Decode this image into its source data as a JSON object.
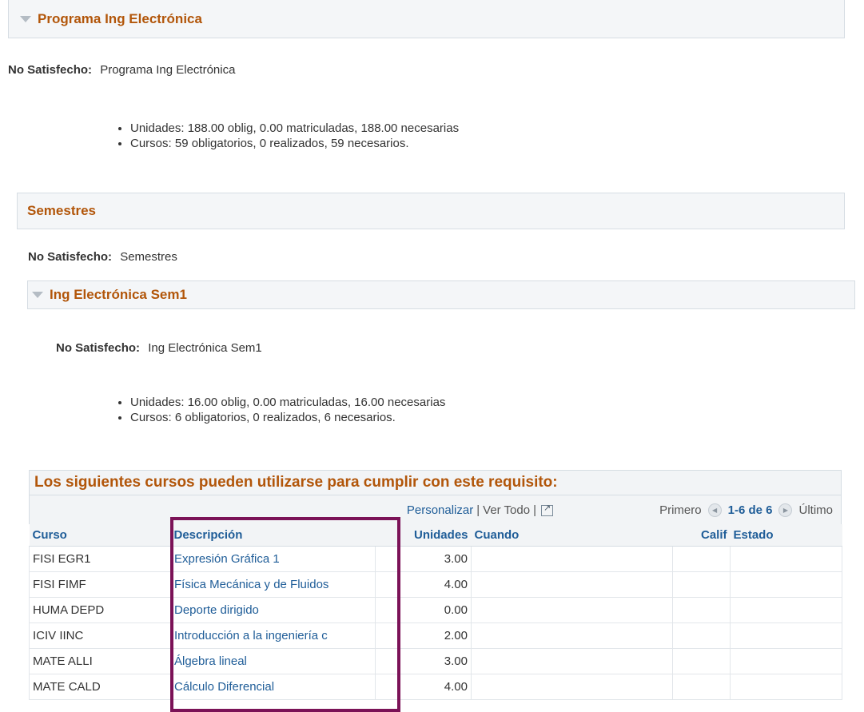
{
  "program": {
    "title": "Programa Ing Electrónica",
    "status_label": "No Satisfecho:",
    "status_value": "Programa Ing Electrónica",
    "facts": [
      "Unidades: 188.00 oblig, 0.00 matriculadas, 188.00 necesarias",
      "Cursos: 59 obligatorios, 0 realizados, 59 necesarios."
    ]
  },
  "semestres": {
    "title": "Semestres",
    "status_label": "No Satisfecho:",
    "status_value": "Semestres"
  },
  "sem1": {
    "title": "Ing Electrónica Sem1",
    "status_label": "No Satisfecho:",
    "status_value": "Ing Electrónica Sem1",
    "facts": [
      "Unidades: 16.00 oblig, 0.00 matriculadas, 16.00 necesarias",
      "Cursos: 6 obligatorios, 0 realizados, 6 necesarios."
    ]
  },
  "grid": {
    "title": "Los siguientes cursos pueden utilizarse para cumplir con este requisito:",
    "personalize": "Personalizar",
    "view_all": "Ver Todo",
    "first": "Primero",
    "range": "1-6 de 6",
    "last": "Último",
    "columns": [
      "Curso",
      "Descripción",
      "Unidades",
      "Cuando",
      "Calif",
      "Estado"
    ],
    "rows": [
      {
        "curso": "FISI EGR1",
        "desc": "Expresión Gráfica 1",
        "unidades": "3.00",
        "cuando": "",
        "calif": "",
        "estado": ""
      },
      {
        "curso": "FISI FIMF",
        "desc": "Física Mecánica y de Fluidos",
        "unidades": "4.00",
        "cuando": "",
        "calif": "",
        "estado": ""
      },
      {
        "curso": "HUMA DEPD",
        "desc": "Deporte dirigido",
        "unidades": "0.00",
        "cuando": "",
        "calif": "",
        "estado": ""
      },
      {
        "curso": "ICIV IINC",
        "desc": "Introducción a la ingeniería c",
        "unidades": "2.00",
        "cuando": "",
        "calif": "",
        "estado": ""
      },
      {
        "curso": "MATE ALLI",
        "desc": "Álgebra lineal",
        "unidades": "3.00",
        "cuando": "",
        "calif": "",
        "estado": ""
      },
      {
        "curso": "MATE CALD",
        "desc": "Cálculo Diferencial",
        "unidades": "4.00",
        "cuando": "",
        "calif": "",
        "estado": ""
      }
    ]
  },
  "colors": {
    "header_text": "#b2560a",
    "link": "#1f5d98",
    "highlight": "#7b1257"
  }
}
